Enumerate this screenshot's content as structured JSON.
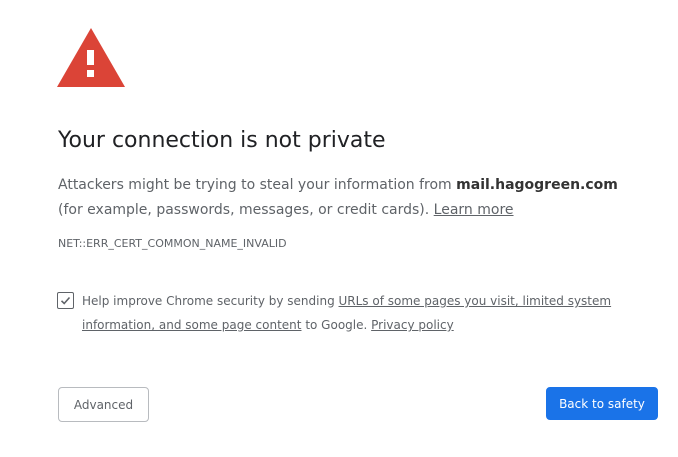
{
  "icon": "warning-triangle-icon",
  "colors": {
    "warning": "#db4437",
    "primary_button": "#1a73e8",
    "text": "#5f6368",
    "heading": "#202124"
  },
  "heading": "Your connection is not private",
  "message": {
    "part1": "Attackers might be trying to steal your information from ",
    "domain": "mail.hagogreen.com",
    "part2": " (for example, passwords, messages, or credit cards). ",
    "learn_more": "Learn more"
  },
  "error_code": "NET::ERR_CERT_COMMON_NAME_INVALID",
  "optin": {
    "checked": true,
    "text1": "Help improve Chrome security by sending ",
    "link1": "URLs of some pages you visit, limited system information, and some page content",
    "text2": " to Google. ",
    "link2": "Privacy policy"
  },
  "buttons": {
    "advanced": "Advanced",
    "back_to_safety": "Back to safety"
  }
}
